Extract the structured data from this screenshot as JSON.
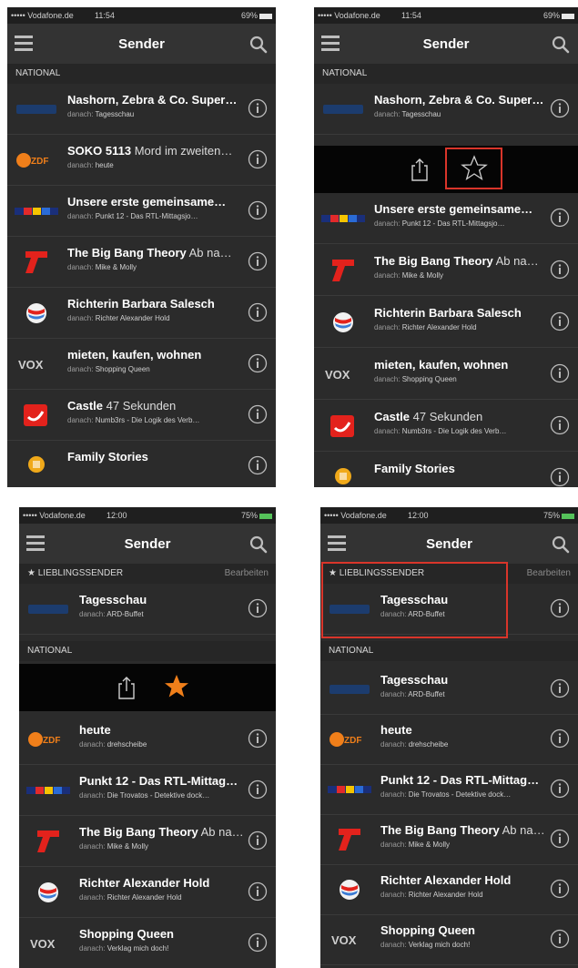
{
  "status_a": {
    "carrier": "••••• Vodafone.de",
    "time": "11:54",
    "battery": "69%"
  },
  "status_b": {
    "carrier": "••••• Vodafone.de",
    "time": "12:00",
    "battery": "75%"
  },
  "nav": {
    "title": "Sender"
  },
  "sections": {
    "national": "NATIONAL",
    "favorites": "★ LIEBLINGSSENDER",
    "edit": "Bearbeiten"
  },
  "then_prefix": "danach:",
  "list_top": [
    {
      "title": "Nashorn, Zebra & Co. Super…",
      "title_rest": "",
      "next": "Tagesschau",
      "logo": "daserste"
    },
    {
      "title": "SOKO 5113",
      "title_rest": " Mord im zweiten…",
      "next": "heute",
      "logo": "zdf"
    },
    {
      "title": "Unsere erste gemeinsame…",
      "title_rest": "",
      "next": "Punkt 12 - Das RTL-Mittagsjo…",
      "logo": "rtl"
    },
    {
      "title": "The Big Bang Theory",
      "title_rest": " Ab na…",
      "next": "Mike & Molly",
      "logo": "pro7"
    },
    {
      "title": "Richterin Barbara Salesch",
      "title_rest": "",
      "next": "Richter Alexander Hold",
      "logo": "sat1"
    },
    {
      "title": "mieten, kaufen, wohnen",
      "title_rest": "",
      "next": "Shopping Queen",
      "logo": "vox"
    },
    {
      "title": "Castle",
      "title_rest": " 47 Sekunden",
      "next": "Numb3rs - Die Logik des Verb…",
      "logo": "kabel1"
    },
    {
      "title": "Family Stories",
      "title_rest": "",
      "next": "",
      "logo": "rtl2"
    }
  ],
  "favorites": [
    {
      "title": "Tagesschau",
      "title_rest": "",
      "next": "ARD-Buffet",
      "logo": "daserste"
    }
  ],
  "list_bottom": [
    {
      "title": "Tagesschau",
      "title_rest": "",
      "next": "ARD-Buffet",
      "logo": "daserste"
    },
    {
      "title": "heute",
      "title_rest": "",
      "next": "drehscheibe",
      "logo": "zdf"
    },
    {
      "title": "Punkt 12  - Das RTL-Mittag…",
      "title_rest": "",
      "next": "Die Trovatos - Detektive dock…",
      "logo": "rtl"
    },
    {
      "title": "The Big Bang Theory",
      "title_rest": " Ab na…",
      "next": "Mike & Molly",
      "logo": "pro7"
    },
    {
      "title": "Richter Alexander Hold",
      "title_rest": "",
      "next": "Richter Alexander Hold",
      "logo": "sat1"
    },
    {
      "title": "Shopping Queen",
      "title_rest": "",
      "next": "Verklag mich doch!",
      "logo": "vox"
    }
  ],
  "colors": {
    "highlight": "#d9352a",
    "star_active": "#f07f1a",
    "background": "#2b2b2b"
  }
}
